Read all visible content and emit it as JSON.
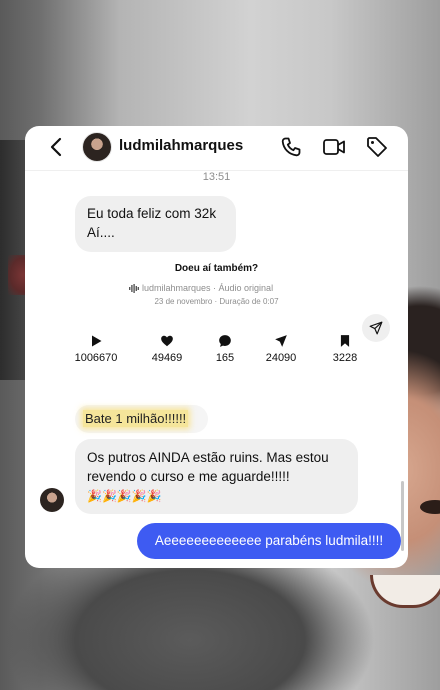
{
  "header": {
    "username": "ludmilahmarques"
  },
  "conversation": {
    "timestamp": "13:51",
    "incoming_message_1": {
      "line1": "Eu toda feliz com 32k",
      "line2": "Aí...."
    },
    "shared_reel": {
      "title": "Doeu aí também?",
      "audio": "ludmilahmarques · Áudio original",
      "date_duration": "23 de novembro · Duração de 0:07",
      "stats": {
        "plays": "1006670",
        "likes": "49469",
        "comments": "165",
        "shares": "24090",
        "saves": "3228"
      }
    },
    "reply_quote": "Bate 1 milhão!!!!!!",
    "incoming_message_2": {
      "line1": "Os putros AINDA estão ruins. Mas estou",
      "line2": "revendo o curso e me aguarde!!!!!",
      "emojis": "🎉🎉🎉🎉🎉"
    },
    "outgoing_message": "Aeeeeeeeeeeeee parabéns ludmila!!!!"
  },
  "colors": {
    "outgoing_bubble": "#3e5bf2",
    "incoming_bubble": "#efefef",
    "highlight": "#f5e59a"
  },
  "icons": [
    "back-icon",
    "phone-icon",
    "video-call-icon",
    "tag-icon",
    "audio-wave-icon",
    "share-icon",
    "play-icon",
    "heart-icon",
    "comment-icon",
    "send-icon",
    "bookmark-icon"
  ]
}
